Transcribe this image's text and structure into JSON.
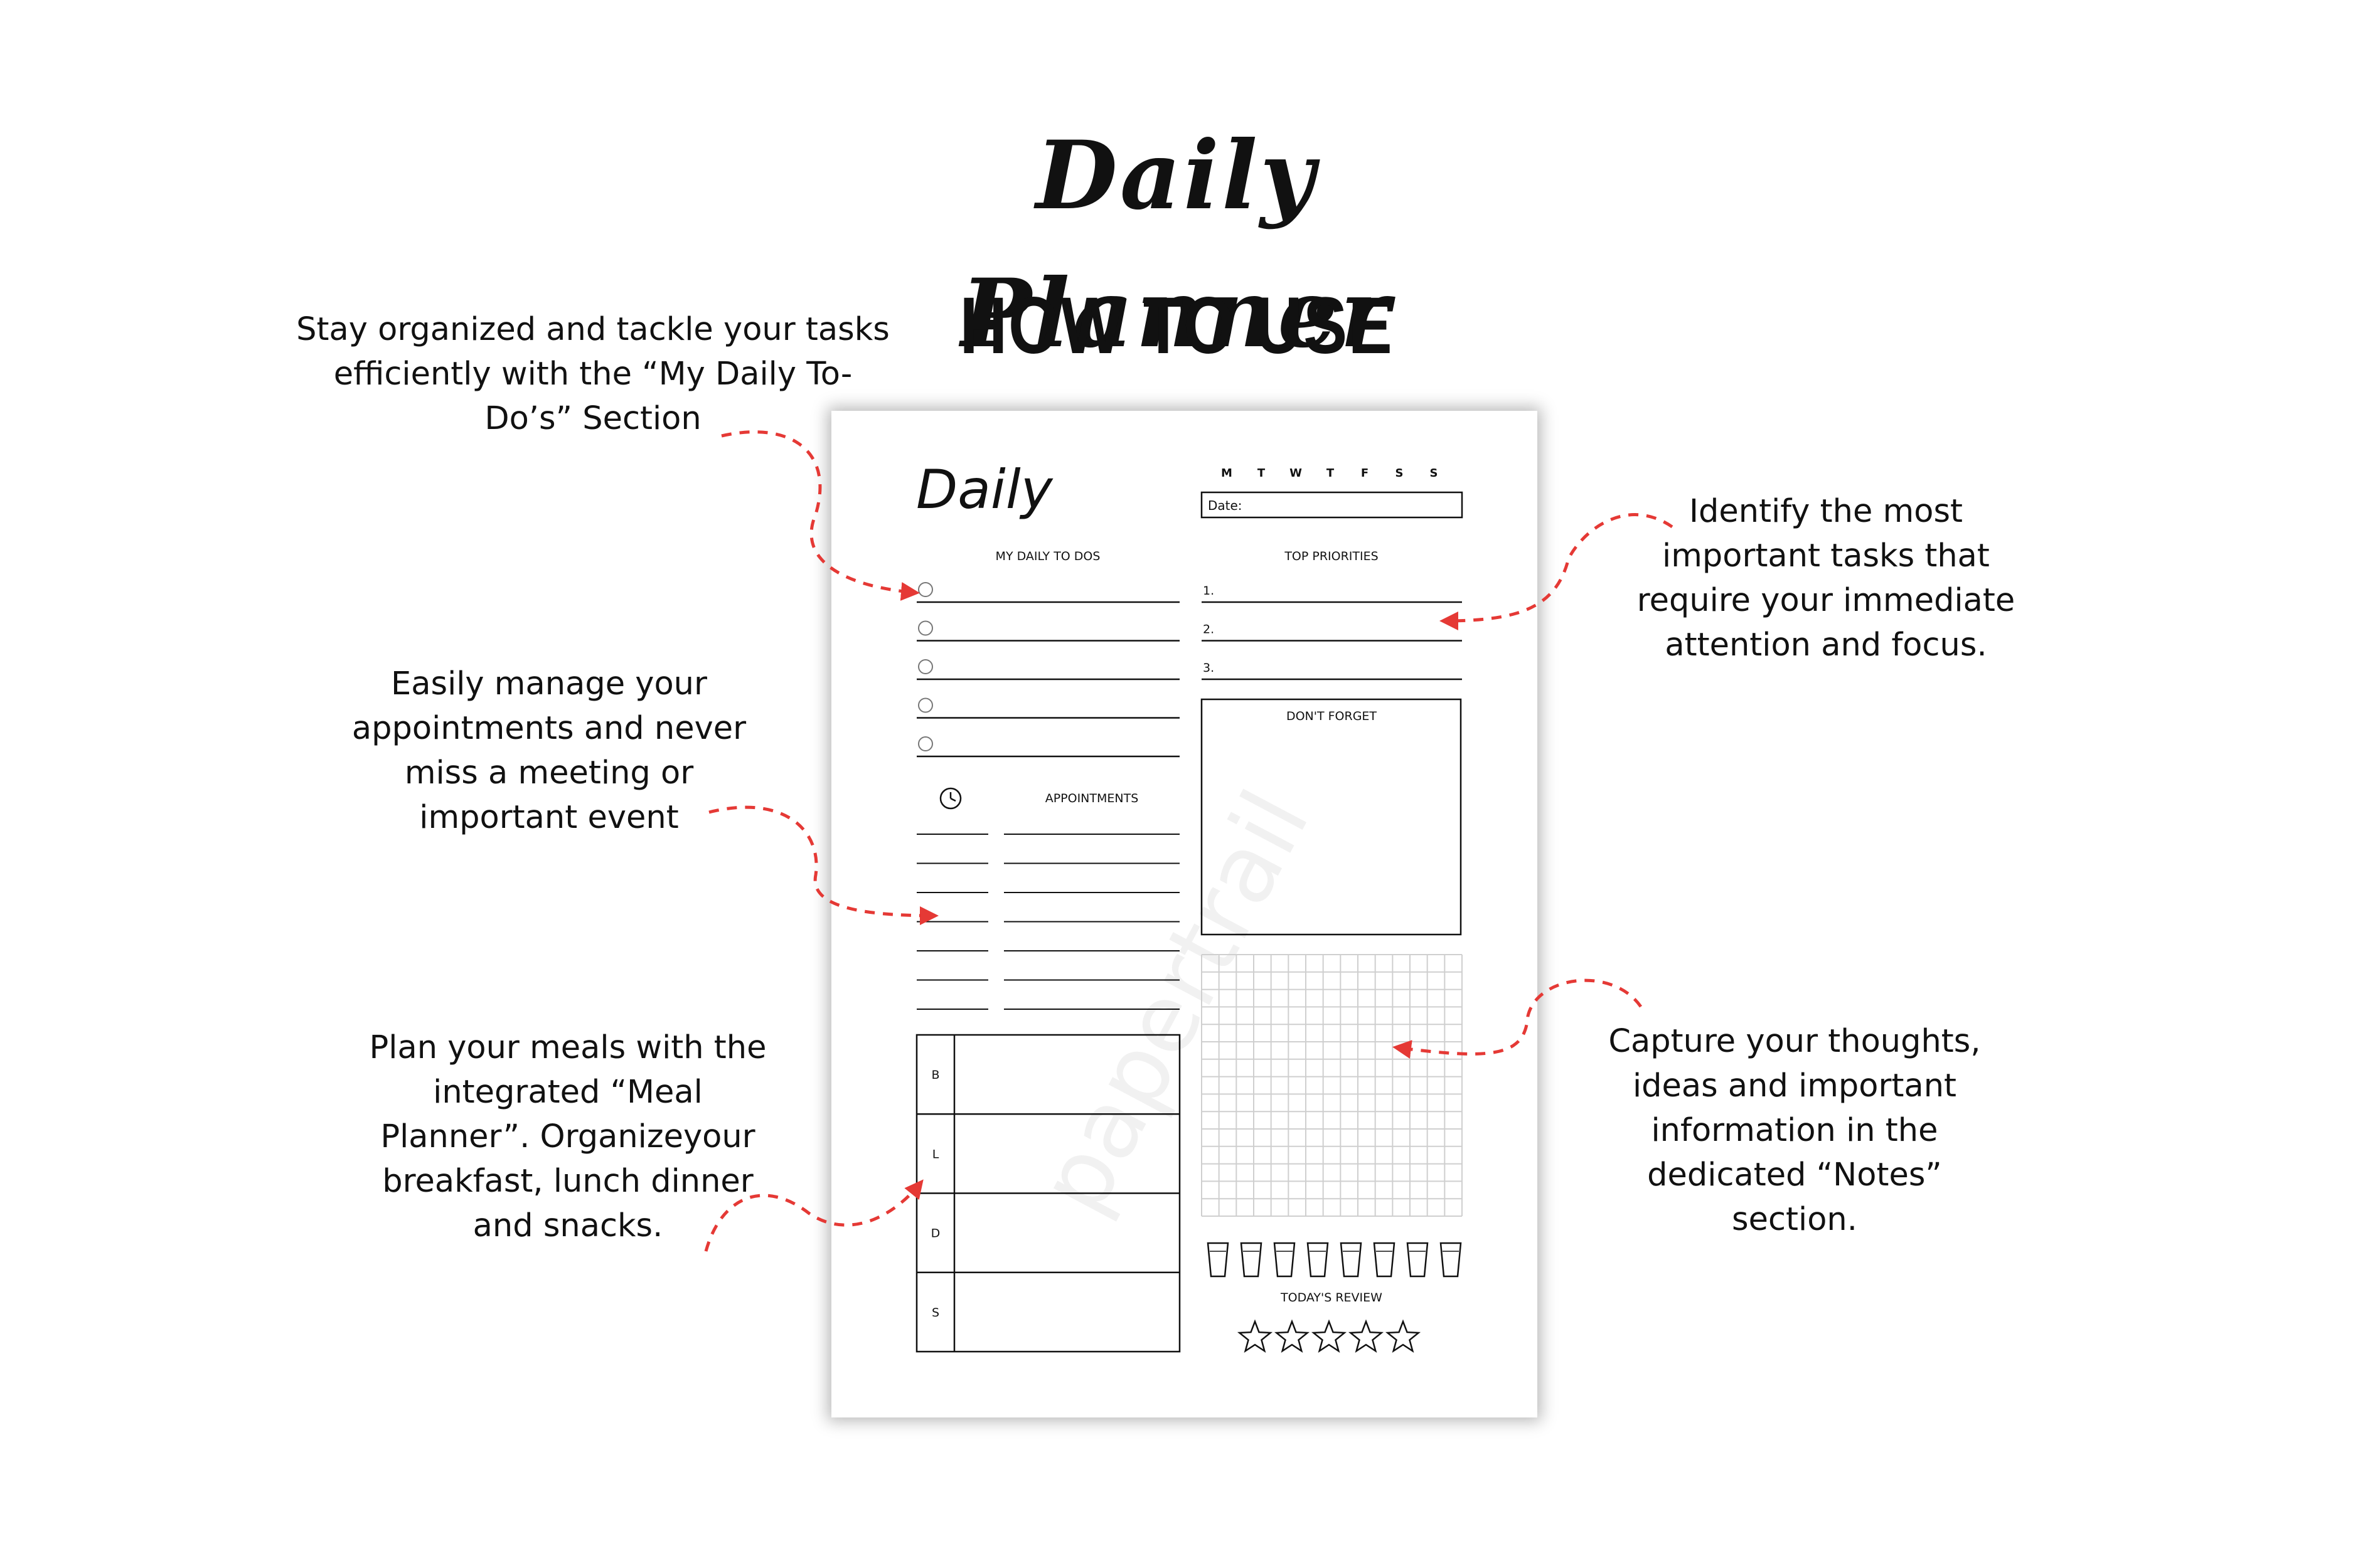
{
  "title": "Daily Planner",
  "subtitle": "HOW TO USE",
  "annotations": {
    "todos": "Stay organized and tackle your tasks\nefficiently with the “My Daily To-\nDo’s” Section",
    "appointments": "Easily manage your\nappointments and never\nmiss a meeting or\nimportant event",
    "meals": "Plan your meals with the\nintegrated  “Meal\nPlanner”. Organizeyour\nbreakfast, lunch dinner\nand snacks.",
    "priorities": "Identify the most\nimportant tasks that\nrequire your immediate\nattention and focus.",
    "notes": "Capture your thoughts,\nideas and important\ninformation in the\ndedicated “Notes”\nsection."
  },
  "planner": {
    "heading": "Daily",
    "weekdays": [
      "M",
      "T",
      "W",
      "T",
      "F",
      "S",
      "S"
    ],
    "date_label": "Date:",
    "todos_title": "MY DAILY TO DOS",
    "priorities_title": "TOP PRIORITIES",
    "priority_numbers": [
      "1.",
      "2.",
      "3."
    ],
    "dont_forget_title": "DON'T FORGET",
    "appointments_title": "APPOINTMENTS",
    "meal_labels": [
      "B",
      "L",
      "D",
      "S"
    ],
    "review_title": "TODAY'S REVIEW",
    "watermark": "papertrail",
    "water_glasses": 8,
    "review_stars": 5
  },
  "colors": {
    "arrow": "#e53935",
    "ink": "#111111",
    "grid": "#cfcfcf"
  }
}
